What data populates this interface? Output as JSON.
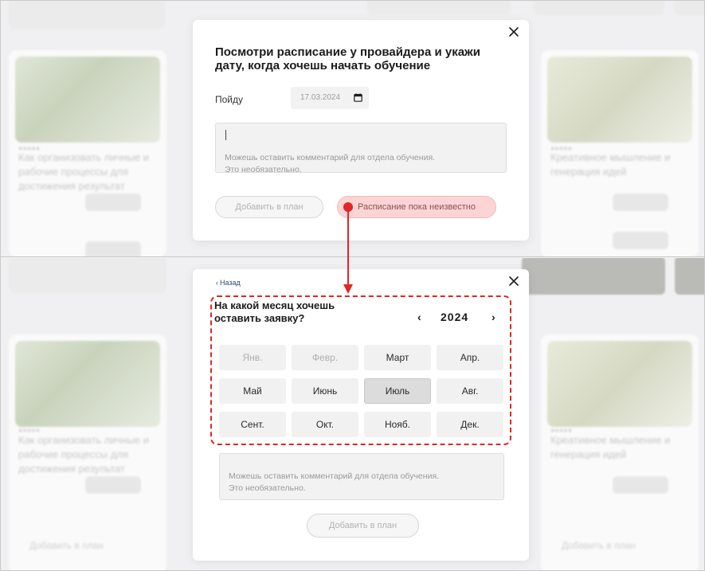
{
  "modal_top": {
    "title": "Посмотри расписание у провайдера и укажи дату, когда хочешь начать обучение",
    "date_label": "Пойду",
    "date_value": "17.03.2024",
    "comment_placeholder": "Можешь оставить комментарий для отдела обучения.\nЭто необязательно.",
    "add_button": "Добавить в план",
    "schedule_button": "Расписание пока неизвестно"
  },
  "modal_bottom": {
    "back_label": "Назад",
    "title": "На какой месяц хочешь оставить заявку?",
    "year": "2024",
    "months": [
      {
        "label": "Янв.",
        "state": "disabled"
      },
      {
        "label": "Февр.",
        "state": "disabled"
      },
      {
        "label": "Март",
        "state": "normal"
      },
      {
        "label": "Апр.",
        "state": "normal"
      },
      {
        "label": "Май",
        "state": "normal"
      },
      {
        "label": "Июнь",
        "state": "normal"
      },
      {
        "label": "Июль",
        "state": "selected"
      },
      {
        "label": "Авг.",
        "state": "normal"
      },
      {
        "label": "Сент.",
        "state": "normal"
      },
      {
        "label": "Окт.",
        "state": "normal"
      },
      {
        "label": "Нояб.",
        "state": "normal"
      },
      {
        "label": "Дек.",
        "state": "normal"
      }
    ],
    "comment_placeholder": "Можешь оставить комментарий для отдела обучения.\nЭто необязательно.",
    "add_button": "Добавить в план"
  },
  "background": {
    "card_left_title": "Как организовать личные и рабочие процессы для достижения результат",
    "card_right_title": "Креативное мышление и генерация идей",
    "card_right_title_top": "Креативное мышление и генерация идей",
    "footer_add": "Добавить в план"
  },
  "colors": {
    "annotation": "#e02626",
    "schedule_button_bg": "#fcd4d4"
  },
  "icons": {
    "close": "close-icon",
    "calendar": "calendar-icon",
    "back": "chevron-left-icon",
    "prev_year": "chevron-left-icon",
    "next_year": "chevron-right-icon"
  }
}
